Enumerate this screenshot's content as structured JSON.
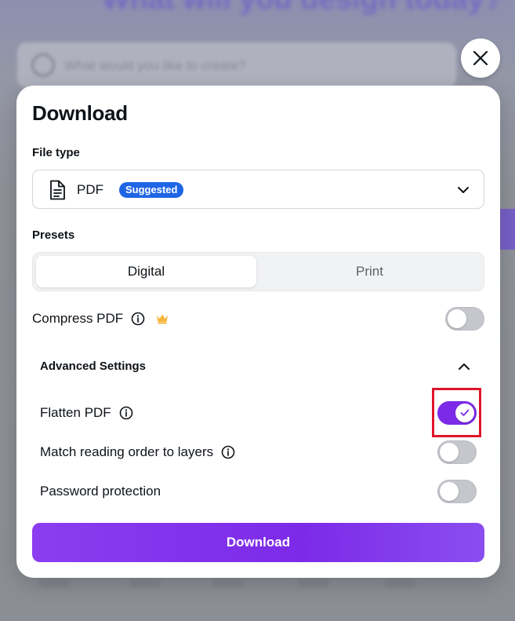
{
  "background": {
    "heading": "What will you design today?",
    "search_placeholder": "What would you like to create?"
  },
  "close_button": {
    "icon": "close-icon"
  },
  "dialog": {
    "title": "Download",
    "file_type": {
      "label": "File type",
      "value": "PDF",
      "badge": "Suggested",
      "icon": "document-icon"
    },
    "presets": {
      "label": "Presets",
      "options": [
        "Digital",
        "Print"
      ],
      "selected": "Digital"
    },
    "compress": {
      "label": "Compress PDF",
      "enabled": false
    },
    "advanced": {
      "label": "Advanced Settings",
      "expanded": true,
      "options": [
        {
          "label": "Flatten PDF",
          "enabled": true,
          "info": true
        },
        {
          "label": "Match reading order to layers",
          "enabled": false,
          "info": true
        },
        {
          "label": "Password protection",
          "enabled": false,
          "info": false
        }
      ]
    },
    "download_button": "Download"
  },
  "colors": {
    "accent": "#7c2ae8",
    "badge": "#1f65e6",
    "highlight": "#e0142a"
  }
}
